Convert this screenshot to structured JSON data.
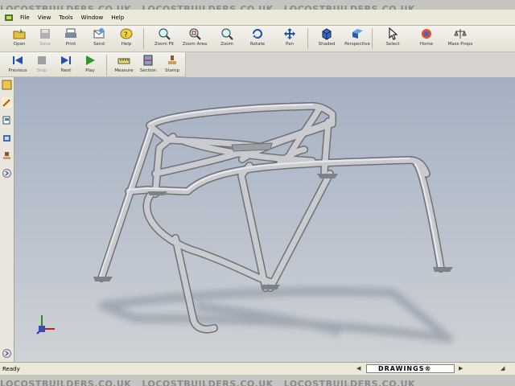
{
  "watermark": "LOCOSTBUILDERS.CO.UK",
  "menu": [
    "File",
    "View",
    "Tools",
    "Window",
    "Help"
  ],
  "toolbar_main": [
    {
      "label": "Open",
      "icon": "open-folder-icon"
    },
    {
      "label": "Save",
      "icon": "save-disk-icon",
      "disabled": true
    },
    {
      "label": "Print",
      "icon": "print-icon"
    },
    {
      "label": "Send",
      "icon": "send-mail-icon"
    },
    {
      "label": "Help",
      "icon": "help-icon"
    },
    {
      "label": "Zoom Fit",
      "icon": "zoom-fit-icon"
    },
    {
      "label": "Zoom Area",
      "icon": "zoom-area-icon"
    },
    {
      "label": "Zoom",
      "icon": "zoom-icon"
    },
    {
      "label": "Rotate",
      "icon": "rotate-icon"
    },
    {
      "label": "Pan",
      "icon": "pan-icon"
    },
    {
      "label": "Shaded",
      "icon": "shaded-cube-icon"
    },
    {
      "label": "Perspective",
      "icon": "perspective-icon"
    },
    {
      "label": "Select",
      "icon": "select-cursor-icon"
    },
    {
      "label": "Home",
      "icon": "home-icon"
    },
    {
      "label": "Mass Props",
      "icon": "mass-props-icon"
    }
  ],
  "toolbar_anim": [
    {
      "label": "Previous",
      "icon": "previous-icon"
    },
    {
      "label": "Stop",
      "icon": "stop-icon",
      "disabled": true
    },
    {
      "label": "Next",
      "icon": "next-icon"
    },
    {
      "label": "Play",
      "icon": "play-icon"
    },
    {
      "label": "Measure",
      "icon": "measure-icon"
    },
    {
      "label": "Section",
      "icon": "section-icon"
    },
    {
      "label": "Stamp",
      "icon": "stamp-icon"
    }
  ],
  "status": {
    "text": "Ready",
    "tab": "DRAWINGS®"
  },
  "colors": {
    "tube": "#c9cbcf",
    "tube_edge": "#6e7278",
    "viewport_top": "#a4b0c1",
    "viewport_bottom": "#cfd2d6"
  }
}
